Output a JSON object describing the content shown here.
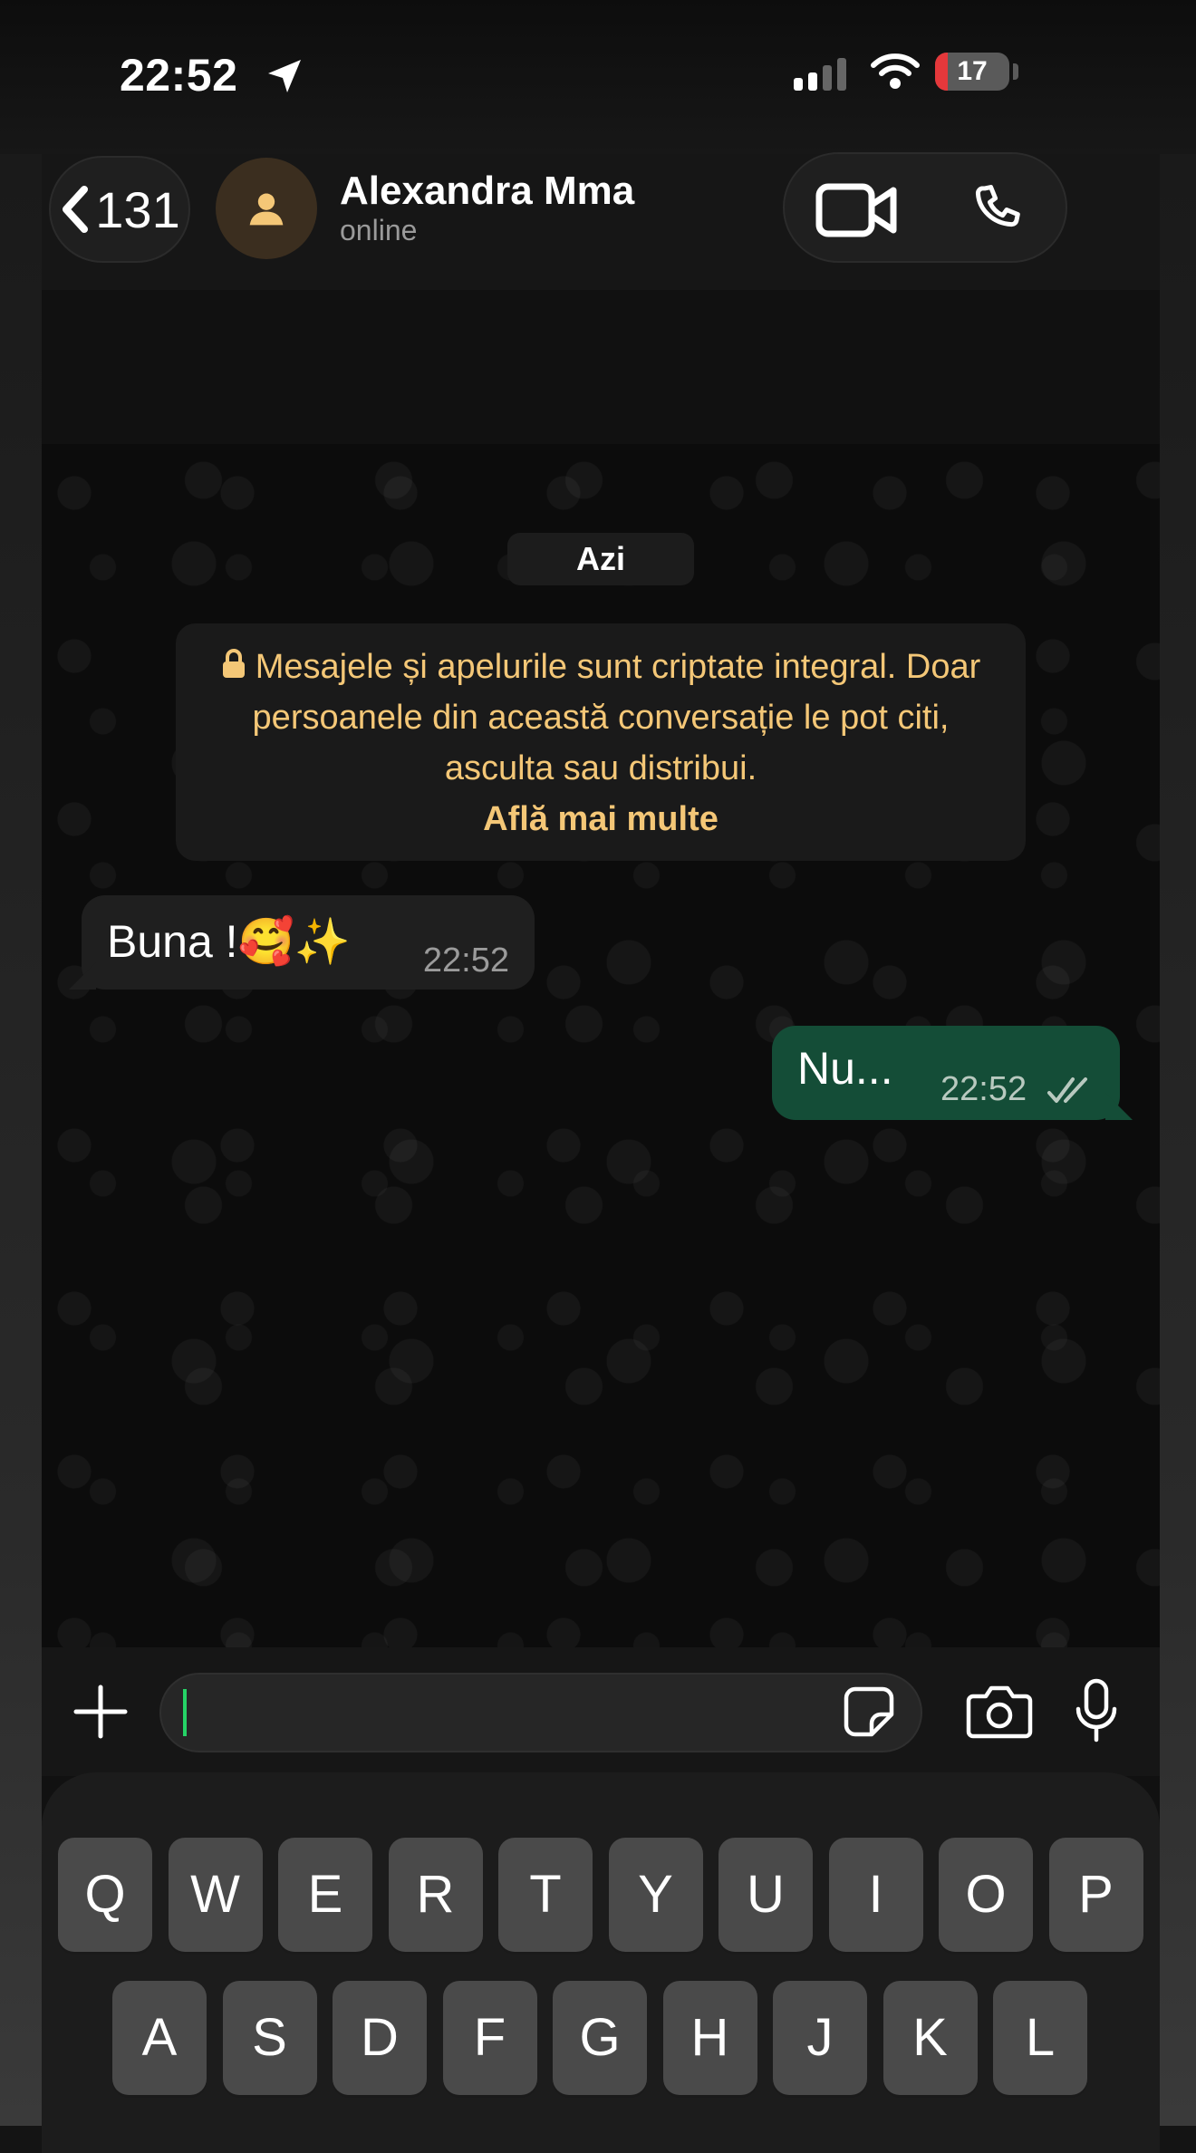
{
  "status_bar": {
    "time": "22:52",
    "battery": "17",
    "battery_level": 0.17
  },
  "header": {
    "back_count": "131",
    "contact_name": "Alexandra Mma",
    "contact_status": "online"
  },
  "chat": {
    "date_label": "Azi",
    "encryption_notice": "Mesajele și apelurile sunt criptate integral. Doar persoanele din această conversație le pot citi, asculta sau distribui.",
    "learn_more": "Află mai multe",
    "messages": [
      {
        "direction": "incoming",
        "text": "Buna !🥰✨",
        "time": "22:52"
      },
      {
        "direction": "outgoing",
        "text": "Nu...",
        "time": "22:52",
        "status": "read"
      }
    ]
  },
  "composer": {
    "input_value": ""
  },
  "keyboard": {
    "row1": [
      "Q",
      "W",
      "E",
      "R",
      "T",
      "Y",
      "U",
      "I",
      "O",
      "P"
    ],
    "row2": [
      "A",
      "S",
      "D",
      "F",
      "G",
      "H",
      "J",
      "K",
      "L"
    ]
  },
  "colors": {
    "outgoing_bubble": "#144d37",
    "incoming_bubble": "#1f1f1f",
    "notice_text": "#f4c777",
    "battery_low": "#e5383b"
  }
}
